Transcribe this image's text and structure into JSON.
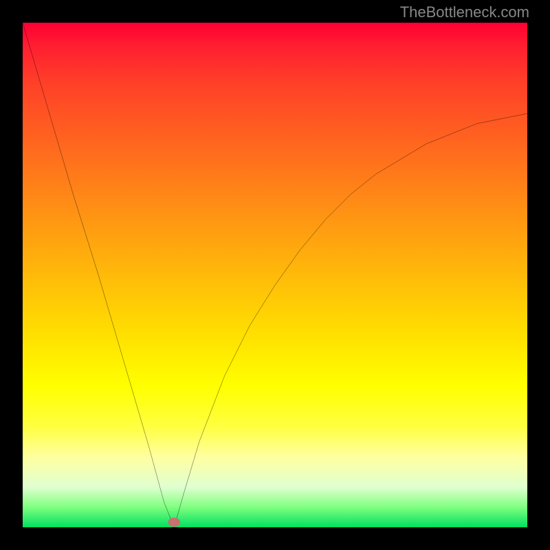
{
  "attribution": "TheBottleneck.com",
  "chart_data": {
    "type": "line",
    "title": "",
    "xlabel": "",
    "ylabel": "",
    "xlim": [
      0,
      100
    ],
    "ylim": [
      0,
      100
    ],
    "background_gradient": {
      "top": "#ff0033",
      "middle": "#ffe000",
      "bottom": "#00e060"
    },
    "series": [
      {
        "name": "left-branch",
        "x": [
          0,
          5,
          10,
          15,
          20,
          25,
          28,
          30
        ],
        "y": [
          100,
          83,
          66,
          50,
          33,
          16,
          5,
          0
        ]
      },
      {
        "name": "right-branch",
        "x": [
          30,
          32,
          35,
          40,
          45,
          50,
          55,
          60,
          65,
          70,
          75,
          80,
          85,
          90,
          95,
          100
        ],
        "y": [
          0,
          7,
          17,
          30,
          40,
          48,
          55,
          61,
          66,
          70,
          73,
          76,
          78,
          80,
          81,
          82
        ]
      }
    ],
    "marker": {
      "x": 30,
      "y": 0,
      "color": "#c97070"
    }
  }
}
